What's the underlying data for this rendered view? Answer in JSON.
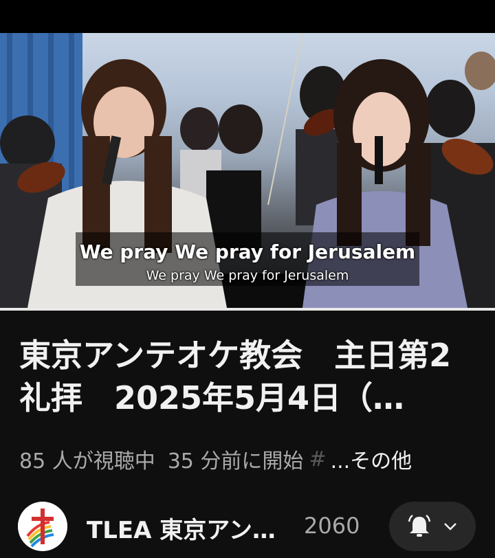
{
  "video": {
    "caption_primary": "We pray We pray for Jerusalem",
    "caption_secondary": "We pray We pray for Jerusalem",
    "progress": 1.0
  },
  "title": "東京アンテオケ教会　主日第2礼拝　2025年5月4日（…",
  "meta": {
    "viewers": "85 人が視聴中",
    "started": "35 分前に開始",
    "faded": "#",
    "more": "...その他"
  },
  "channel": {
    "name": "TLEA 東京アンテオケ教会",
    "subscribers": "2060",
    "bell_icon": "bell-icon",
    "chevron_icon": "chevron-down-icon"
  },
  "colors": {
    "background": "#0f0f0f",
    "secondary_text": "#aaaaaa",
    "button_bg": "#272727"
  }
}
